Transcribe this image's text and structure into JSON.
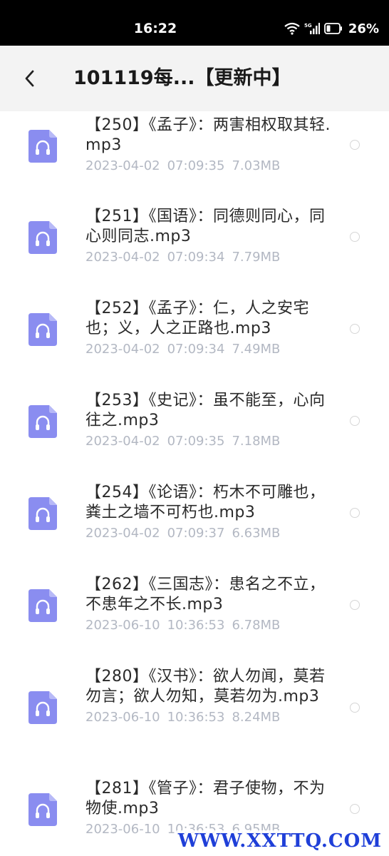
{
  "status": {
    "time": "16:22",
    "network": "5G",
    "battery": "26%"
  },
  "header": {
    "title": "101119每...【更新中】"
  },
  "icons": {
    "back": "chevron-left-icon",
    "file": "audio-file-headphones-icon",
    "wifi": "wifi-icon",
    "signal": "signal-icon",
    "battery": "battery-icon"
  },
  "colors": {
    "accent": "#8a8df0",
    "meta_text": "#b3b8c3",
    "watermark": "#1f3fd8"
  },
  "files": [
    {
      "name": "【250】《孟子》：两害相权取其轻.mp3",
      "date": "2023-04-02",
      "time": "07:09:35",
      "size": "7.03MB"
    },
    {
      "name": "【251】《国语》：同德则同心，同心则同志.mp3",
      "date": "2023-04-02",
      "time": "07:09:34",
      "size": "7.79MB"
    },
    {
      "name": "【252】《孟子》：仁，人之安宅也；义，人之正路也.mp3",
      "date": "2023-04-02",
      "time": "07:09:34",
      "size": "7.49MB"
    },
    {
      "name": "【253】《史记》：虽不能至，心向往之.mp3",
      "date": "2023-04-02",
      "time": "07:09:35",
      "size": "7.18MB"
    },
    {
      "name": "【254】《论语》：朽木不可雕也，粪土之墙不可朽也.mp3",
      "date": "2023-04-02",
      "time": "07:09:37",
      "size": "6.63MB"
    },
    {
      "name": "【262】《三国志》：患名之不立，不患年之不长.mp3",
      "date": "2023-06-10",
      "time": "10:36:53",
      "size": "6.78MB"
    },
    {
      "name": "【280】《汉书》：欲人勿闻，莫若勿言；欲人勿知，莫若勿为.mp3",
      "date": "2023-06-10",
      "time": "10:36:53",
      "size": "8.24MB"
    },
    {
      "name": "【281】《管子》：君子使物，不为物使.mp3",
      "date": "2023-06-10",
      "time": "10:36:53",
      "size": "6.95MB"
    }
  ],
  "watermark": "WWW.XXTTQ.COM"
}
